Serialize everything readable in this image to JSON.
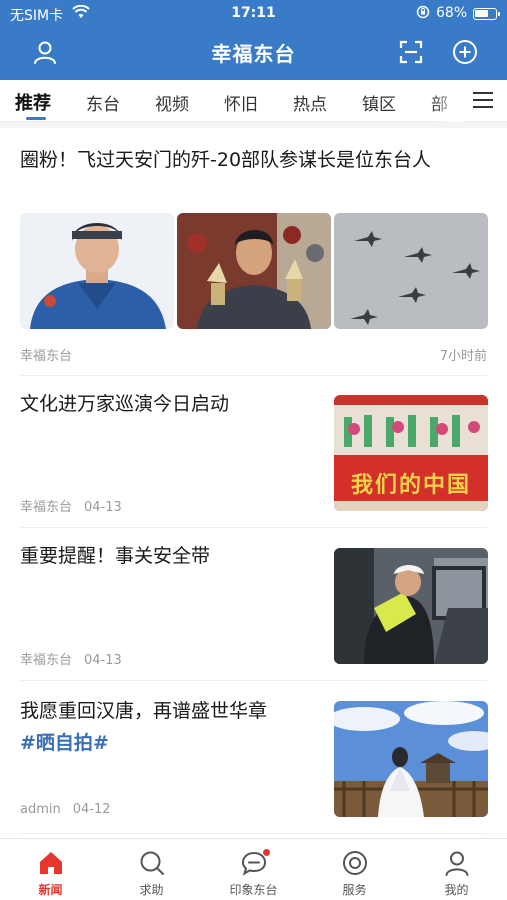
{
  "status_bar": {
    "carrier": "无SIM卡",
    "time": "17:11",
    "battery_percent": "68%",
    "battery_level": 0.68
  },
  "header": {
    "title": "幸福东台",
    "left_icon": "user-icon",
    "right_icons": [
      "scan-icon",
      "add-circle-icon"
    ],
    "background": "#3a7bc8"
  },
  "tabs": {
    "items": [
      "推荐",
      "东台",
      "视频",
      "怀旧",
      "热点",
      "镇区",
      "部"
    ],
    "active": "推荐",
    "menu_icon": "menu-icon"
  },
  "articles": [
    {
      "title": "圈粉！飞过天安门的歼-20部队参谋长是位东台人",
      "source": "幸福东台",
      "time": "7小时前"
    },
    {
      "title": "文化进万家巡演今日启动",
      "source": "幸福东台",
      "date": "04-13",
      "image_text": "我们的中国"
    },
    {
      "title": "重要提醒！事关安全带",
      "source": "幸福东台",
      "date": "04-13"
    },
    {
      "title": "我愿重回汉唐，再谱盛世华章",
      "hashtag": "#晒自拍#",
      "source": "admin",
      "date": "04-12"
    }
  ],
  "bottom_nav": {
    "items": [
      {
        "label": "新闻",
        "icon": "home-icon",
        "active": true
      },
      {
        "label": "求助",
        "icon": "search-icon",
        "active": false
      },
      {
        "label": "印象东台",
        "icon": "chat-bubble-icon",
        "active": false,
        "badge": true
      },
      {
        "label": "服务",
        "icon": "service-icon",
        "active": false
      },
      {
        "label": "我的",
        "icon": "profile-icon",
        "active": false
      }
    ],
    "active_color": "#e5372e"
  }
}
